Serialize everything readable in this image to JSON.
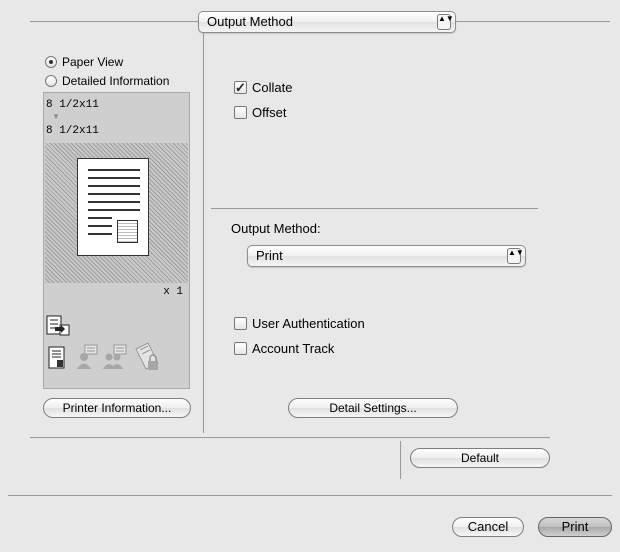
{
  "header": {
    "panel_popup": "Output Method"
  },
  "preview_panel": {
    "radios": [
      {
        "label": "Paper View",
        "selected": true
      },
      {
        "label": "Detailed Information",
        "selected": false
      }
    ],
    "paper_from": "8 1/2x11",
    "paper_to": "8 1/2x11",
    "copies": "x 1",
    "printer_info_button": "Printer Information..."
  },
  "options": {
    "collate": {
      "label": "Collate",
      "checked": true
    },
    "offset": {
      "label": "Offset",
      "checked": false
    },
    "output_method_label": "Output Method:",
    "output_method_value": "Print",
    "user_auth": {
      "label": "User Authentication",
      "checked": false
    },
    "account_track": {
      "label": "Account Track",
      "checked": false
    },
    "detail_settings_button": "Detail Settings..."
  },
  "footer": {
    "default_button": "Default",
    "cancel_button": "Cancel",
    "print_button": "Print"
  },
  "glyphs": {
    "check": "✓",
    "popup_arrows": "▲▼",
    "arrow_down": "▼"
  }
}
